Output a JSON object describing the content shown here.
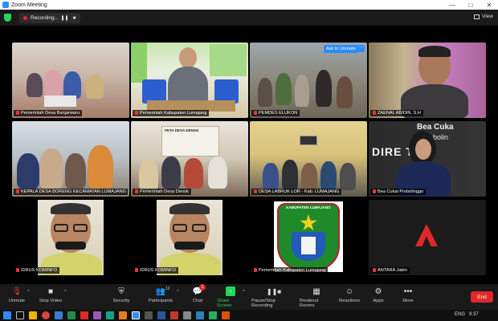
{
  "window": {
    "title": "Zoom Meeting",
    "controls": [
      "—",
      "□",
      "✕"
    ]
  },
  "topbar": {
    "recording_label": "Recording...",
    "view_label": "View"
  },
  "tiles": [
    {
      "name": "Pemerintah Desa Banjarwaru",
      "muted": true
    },
    {
      "name": "Pemerintah Kabupaten Lumajang",
      "muted": true
    },
    {
      "name": "PEMDES ELUKON",
      "muted": true,
      "ask_unmute": "Ask to Unmute"
    },
    {
      "name": "ZAENAL ABIDIN, S.H",
      "muted": true,
      "active": true
    },
    {
      "name": "KEPALA DESA BORENG KECAMATAN LUMAJANG",
      "muted": true
    },
    {
      "name": "Pemerintah Desa Denok",
      "muted": true,
      "sign_text": "PETA DESA DENOK"
    },
    {
      "name": "DESA LABRUK LOR - Kab. LUMAJANG",
      "muted": true
    },
    {
      "name": "Bea Cukai Probolinggo",
      "muted": true,
      "banner_text": "Bea Cuka",
      "banner_text_2": "Probolin",
      "banner_text_3": "DIRE TNTI"
    },
    {
      "name": "IDRUS KOMINFO",
      "muted": true
    },
    {
      "name": "IDRUS KOMINFO",
      "muted": true
    },
    {
      "name": "Pemerintah Kabupaten Lumajang",
      "muted": true,
      "logo_text": "KABUPATEN LUMAJANG"
    },
    {
      "name": "ANTARA Jatim",
      "muted": true
    }
  ],
  "controls": {
    "unmute": "Unmute",
    "stop_video": "Stop Video",
    "security": "Security",
    "participants": "Participants",
    "participants_count": "12",
    "chat": "Chat",
    "chat_badge": "1",
    "share_screen": "Share Screen",
    "pause_recording": "Pause/Stop Recording",
    "breakout_rooms": "Breakout Rooms",
    "reactions": "Reactions",
    "apps": "Apps",
    "more": "More",
    "end": "End"
  },
  "taskbar": {
    "language": "ENG",
    "time": "9:37"
  },
  "colors": {
    "active_border": "#e9e244",
    "end_red": "#e02828",
    "share_green": "#23d959",
    "zoom_blue": "#2d8cff"
  }
}
